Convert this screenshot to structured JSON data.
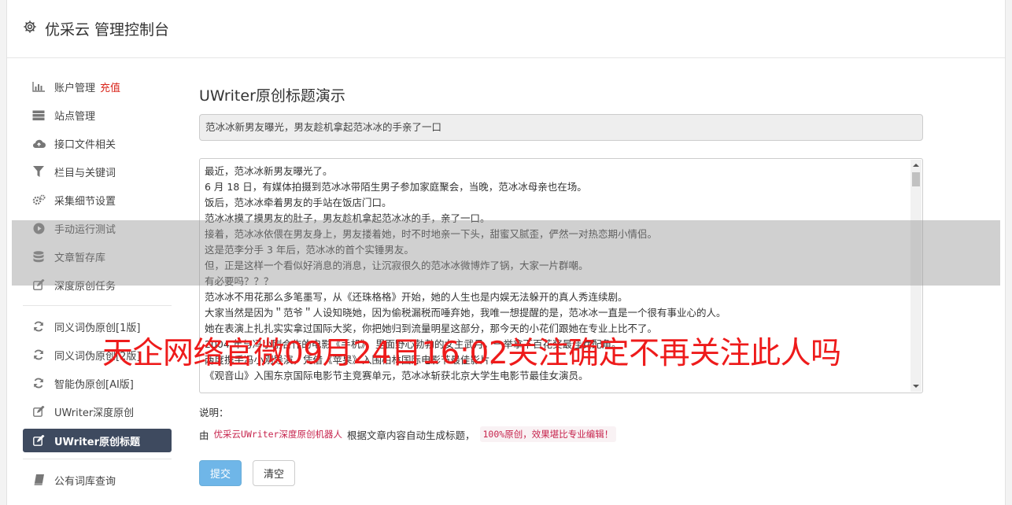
{
  "app": {
    "title": "优采云 管理控制台",
    "brand_icon": "gear-icon"
  },
  "sidebar": {
    "items": [
      {
        "label": "账户管理",
        "badge": "充值",
        "icon": "bar-chart-icon"
      },
      {
        "label": "站点管理",
        "icon": "server-icon"
      },
      {
        "label": "接口文件相关",
        "icon": "cloud-upload-icon"
      },
      {
        "label": "栏目与关键词",
        "icon": "filter-icon"
      },
      {
        "label": "采集细节设置",
        "icon": "cogs-icon"
      },
      {
        "label": "手动运行测试",
        "icon": "play-circle-icon"
      },
      {
        "label": "文章暂存库",
        "icon": "database-icon"
      },
      {
        "label": "深度原创任务",
        "icon": "edit-icon"
      },
      {
        "label": "同义词伪原创[1版]",
        "icon": "refresh-icon"
      },
      {
        "label": "同义词伪原创[2版]",
        "icon": "refresh-icon"
      },
      {
        "label": "智能伪原创[AI版]",
        "icon": "refresh-icon"
      },
      {
        "label": "UWriter深度原创",
        "icon": "edit-icon"
      },
      {
        "label": "UWriter原创标题",
        "icon": "edit-icon",
        "active": true
      },
      {
        "label": "公有词库查询",
        "icon": "book-icon"
      }
    ]
  },
  "main": {
    "page_title": "UWriter原创标题演示",
    "title_value": "范冰冰新男友曝光，男友趁机拿起范冰冰的手亲了一口",
    "article_lines": [
      "最近，范冰冰新男友曝光了。",
      "6 月 18 日，有媒体拍摄到范冰冰带陌生男子参加家庭聚会，当晚，范冰冰母亲也在场。",
      "饭后，范冰冰牵着男友的手站在饭店门口。",
      "范冰冰摸了摸男友的肚子，男友趁机拿起范冰冰的手，亲了一口。",
      "接着，范冰冰依偎在男友身上，男友搂着她，时不时地亲一下头，甜蜜又腻歪，俨然一对热恋期小情侣。",
      "这是范李分手 3 年后，范冰冰的首个实锤男友。",
      "但，正是这样一个看似好消息的消息，让沉寂很久的范冰冰微博炸了锅，大家一片群嘲。",
      "有必要吗？？？",
      "范冰冰不用花那么多笔墨写，从《还珠格格》开始，她的人生也是内娱无法躲开的真人秀连续剧。",
      "大家当然是因为＂范爷＂人设知晓她，因为偷税漏税而唾弃她，我唯一想提醒的是，范冰冰一直是一个很有事业心的人。",
      "她在表演上扎扎实实拿过国际大奖，你把她归到流量明星这部分，那今天的小花们跟她在专业上比不了。",
      "2004 年与冯小刚合作的电影《手机》，里面野心勃勃的女主武月，一举拿下百花奖最佳女配角。",
      "两度携手冯小刚导演，凭借《苹果》入围柏林国际电影节最佳影片，",
      "《观音山》入围东京国际电影节主竞赛单元，范冰冰斩获北京大学生电影节最佳女演员。"
    ],
    "note_label": "说明：",
    "note_prefix": "由",
    "note_link": "优采云UWriter深度原创机器人",
    "note_middle": "根据文章内容自动生成标题，",
    "note_highlight": "100%原创，效果堪比专业编辑！",
    "submit_label": "提交",
    "clear_label": "清空"
  },
  "overlay": {
    "banner_text": "天企网络官微09月24日16:02关注确定不再关注此人吗"
  }
}
